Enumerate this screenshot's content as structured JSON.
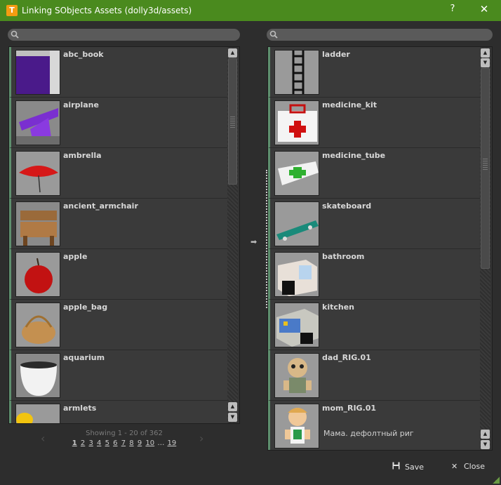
{
  "window": {
    "title": "Linking SObjects Assets (dolly3d/assets)",
    "help_label": "?",
    "close_label": "✕",
    "accent": "#4a8a1e"
  },
  "left_panel": {
    "search_placeholder": "",
    "items": [
      {
        "name": "abc_book"
      },
      {
        "name": "airplane"
      },
      {
        "name": "ambrella"
      },
      {
        "name": "ancient_armchair"
      },
      {
        "name": "apple"
      },
      {
        "name": "apple_bag"
      },
      {
        "name": "aquarium"
      },
      {
        "name": "armlets"
      }
    ],
    "pager": {
      "status": "Showing 1 - 20 of 362",
      "pages": [
        "1",
        "2",
        "3",
        "4",
        "5",
        "6",
        "7",
        "8",
        "9",
        "10"
      ],
      "ellipsis": "…",
      "last_page": "19",
      "prev": "‹",
      "next": "›"
    }
  },
  "right_panel": {
    "search_placeholder": "",
    "items": [
      {
        "name": "ladder",
        "desc": ""
      },
      {
        "name": "medicine_kit",
        "desc": ""
      },
      {
        "name": "medicine_tube",
        "desc": ""
      },
      {
        "name": "skateboard",
        "desc": ""
      },
      {
        "name": "bathroom",
        "desc": ""
      },
      {
        "name": "kitchen",
        "desc": ""
      },
      {
        "name": "dad_RIG.01",
        "desc": ""
      },
      {
        "name": "mom_RIG.01",
        "desc": "Мама. дефолтный риг"
      }
    ]
  },
  "splitter_arrow": "➡",
  "footer": {
    "save_label": "Save",
    "close_label": "Close"
  }
}
